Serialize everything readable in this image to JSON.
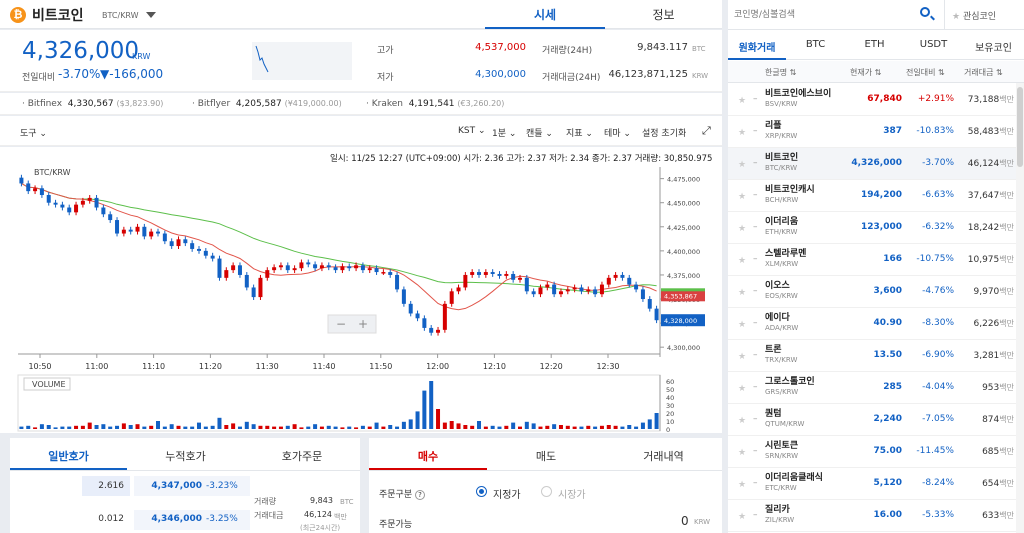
{
  "header": {
    "coin_name": "비트코인",
    "pair": "BTC/KRW",
    "tab_sise": "시세",
    "tab_info": "정보",
    "coin_symbol": "₿"
  },
  "price": {
    "current": "4,326,000",
    "unit": "KRW",
    "prev_label": "전일대비",
    "change_pct": "-3.70%",
    "change_amt": "▼-166,000"
  },
  "stats": {
    "high_label": "고가",
    "high": "4,537,000",
    "low_label": "저가",
    "low": "4,300,000",
    "vol_label": "거래량(24H)",
    "vol": "9,843.117",
    "vol_unit": "BTC",
    "amt_label": "거래대금(24H)",
    "amt": "46,123,871,125",
    "amt_unit": "KRW"
  },
  "exchanges": [
    {
      "name": "Bitfinex",
      "price": "4,330,567",
      "sub": "($3,823.90)"
    },
    {
      "name": "Bitflyer",
      "price": "4,205,587",
      "sub": "(¥419,000.00)"
    },
    {
      "name": "Kraken",
      "price": "4,191,541",
      "sub": "(€3,260.20)"
    }
  ],
  "toolbar": {
    "tools": "도구",
    "tz": "KST",
    "interval": "1분",
    "candle": "캔들",
    "indicator": "지표",
    "theme": "테마",
    "reset": "설정 초기화"
  },
  "chart_info": {
    "symbol": "BTC/KRW",
    "ohlc": "일시: 11/25 12:27 (UTC+09:00) 시가: 2.36 고가: 2.37 저가: 2.34 종가: 2.37 거래량: 30,850.975",
    "volume_label": "VOLUME",
    "price_label_red": "4,353,867",
    "price_label_blue": "4,328,000"
  },
  "chart_data": {
    "type": "candlestick",
    "x_ticks": [
      "10:50",
      "11:00",
      "11:10",
      "11:20",
      "11:30",
      "11:40",
      "11:50",
      "12:00",
      "12:10",
      "12:20",
      "12:30"
    ],
    "y_ticks": [
      "4,475,000",
      "4,450,000",
      "4,425,000",
      "4,400,000",
      "4,375,000",
      "4,350,000",
      "4,325,000",
      "4,300,000"
    ],
    "ylim": [
      4295000,
      4485000
    ],
    "vol_ticks": [
      "60",
      "50",
      "40",
      "30",
      "20",
      "10",
      "0"
    ],
    "vol_ylim": [
      0,
      65
    ],
    "close": [
      4470000,
      4462000,
      4465000,
      4458000,
      4450000,
      4448000,
      4445000,
      4440000,
      4448000,
      4452000,
      4455000,
      4445000,
      4438000,
      4432000,
      4418000,
      4422000,
      4420000,
      4425000,
      4415000,
      4420000,
      4418000,
      4410000,
      4405000,
      4412000,
      4408000,
      4402000,
      4400000,
      4395000,
      4392000,
      4372000,
      4380000,
      4385000,
      4375000,
      4362000,
      4352000,
      4372000,
      4380000,
      4383000,
      4385000,
      4380000,
      4382000,
      4388000,
      4386000,
      4382000,
      4385000,
      4383000,
      4380000,
      4384000,
      4382000,
      4385000,
      4380000,
      4382000,
      4378000,
      4378000,
      4375000,
      4360000,
      4345000,
      4335000,
      4330000,
      4320000,
      4315000,
      4318000,
      4345000,
      4358000,
      4362000,
      4375000,
      4378000,
      4375000,
      4378000,
      4376000,
      4374000,
      4376000,
      4370000,
      4372000,
      4358000,
      4355000,
      4362000,
      4365000,
      4355000,
      4358000,
      4360000,
      4362000,
      4358000,
      4360000,
      4355000,
      4365000,
      4372000,
      4375000,
      4372000,
      4365000,
      4360000,
      4350000,
      4340000,
      4328000
    ],
    "volume": [
      3,
      4,
      2,
      6,
      5,
      2,
      3,
      3,
      4,
      4,
      8,
      5,
      6,
      3,
      4,
      7,
      5,
      6,
      3,
      4,
      10,
      3,
      6,
      4,
      3,
      3,
      8,
      3,
      4,
      14,
      5,
      7,
      3,
      9,
      6,
      4,
      4,
      3,
      3,
      4,
      6,
      2,
      3,
      6,
      3,
      4,
      3,
      2,
      3,
      2,
      4,
      3,
      8,
      3,
      5,
      3,
      9,
      12,
      22,
      48,
      60,
      25,
      8,
      10,
      7,
      5,
      4,
      10,
      3,
      4,
      3,
      4,
      8,
      3,
      9,
      7,
      3,
      4,
      6,
      5,
      4,
      3,
      3,
      4,
      3,
      4,
      5,
      4,
      3,
      5,
      3,
      8,
      12,
      20
    ],
    "ma_short_label": "MA red",
    "ma_long_label": "MA green"
  },
  "bottom_left": {
    "tabs": [
      "일반호가",
      "누적호가",
      "호가주문"
    ],
    "rows": [
      {
        "qty": "2.616",
        "price": "4,347,000",
        "pct": "-3.23%"
      },
      {
        "qty": "0.012",
        "price": "4,346,000",
        "pct": "-3.25%"
      }
    ],
    "side": {
      "vol_label": "거래량",
      "vol": "9,843",
      "vol_unit": "BTC",
      "amt_label": "거래대금",
      "amt": "46,124",
      "amt_unit": "백만",
      "note": "(최근24시간)"
    }
  },
  "bottom_right": {
    "tabs": [
      "매수",
      "매도",
      "거래내역"
    ],
    "order_type_label": "주문구분",
    "limit": "지정가",
    "market": "시장가",
    "avail_label": "주문가능",
    "avail": "0",
    "avail_unit": "KRW"
  },
  "right": {
    "search_placeholder": "코인명/심볼검색",
    "watch": "관심코인",
    "tabs": [
      "원화거래",
      "BTC",
      "ETH",
      "USDT",
      "보유코인"
    ],
    "cols": [
      "한글명",
      "현재가",
      "전일대비",
      "거래대금"
    ],
    "coins": [
      {
        "name": "비트코인에스브이",
        "pair": "BSV/KRW",
        "price": "67,840",
        "pct": "+2.91%",
        "vol": "73,188",
        "dir": "up"
      },
      {
        "name": "리플",
        "pair": "XRP/KRW",
        "price": "387",
        "pct": "-10.83%",
        "vol": "58,483",
        "dir": "dn"
      },
      {
        "name": "비트코인",
        "pair": "BTC/KRW",
        "price": "4,326,000",
        "pct": "-3.70%",
        "vol": "46,124",
        "dir": "dn"
      },
      {
        "name": "비트코인캐시",
        "pair": "BCH/KRW",
        "price": "194,200",
        "pct": "-6.63%",
        "vol": "37,647",
        "dir": "dn"
      },
      {
        "name": "이더리움",
        "pair": "ETH/KRW",
        "price": "123,000",
        "pct": "-6.32%",
        "vol": "18,242",
        "dir": "dn"
      },
      {
        "name": "스텔라루멘",
        "pair": "XLM/KRW",
        "price": "166",
        "pct": "-10.75%",
        "vol": "10,975",
        "dir": "dn"
      },
      {
        "name": "이오스",
        "pair": "EOS/KRW",
        "price": "3,600",
        "pct": "-4.76%",
        "vol": "9,970",
        "dir": "dn"
      },
      {
        "name": "에이다",
        "pair": "ADA/KRW",
        "price": "40.90",
        "pct": "-8.30%",
        "vol": "6,226",
        "dir": "dn"
      },
      {
        "name": "트론",
        "pair": "TRX/KRW",
        "price": "13.50",
        "pct": "-6.90%",
        "vol": "3,281",
        "dir": "dn"
      },
      {
        "name": "그로스톨코인",
        "pair": "GRS/KRW",
        "price": "285",
        "pct": "-4.04%",
        "vol": "953",
        "dir": "dn"
      },
      {
        "name": "퀀텀",
        "pair": "QTUM/KRW",
        "price": "2,240",
        "pct": "-7.05%",
        "vol": "874",
        "dir": "dn"
      },
      {
        "name": "시린토큰",
        "pair": "SRN/KRW",
        "price": "75.00",
        "pct": "-11.45%",
        "vol": "685",
        "dir": "dn"
      },
      {
        "name": "이더리움클래식",
        "pair": "ETC/KRW",
        "price": "5,120",
        "pct": "-8.24%",
        "vol": "654",
        "dir": "dn"
      },
      {
        "name": "질리카",
        "pair": "ZIL/KRW",
        "price": "16.00",
        "pct": "-5.33%",
        "vol": "633",
        "dir": "dn"
      }
    ],
    "vol_unit": "백만"
  },
  "colors": {
    "blue": "#1261c4",
    "red": "#d60000"
  }
}
